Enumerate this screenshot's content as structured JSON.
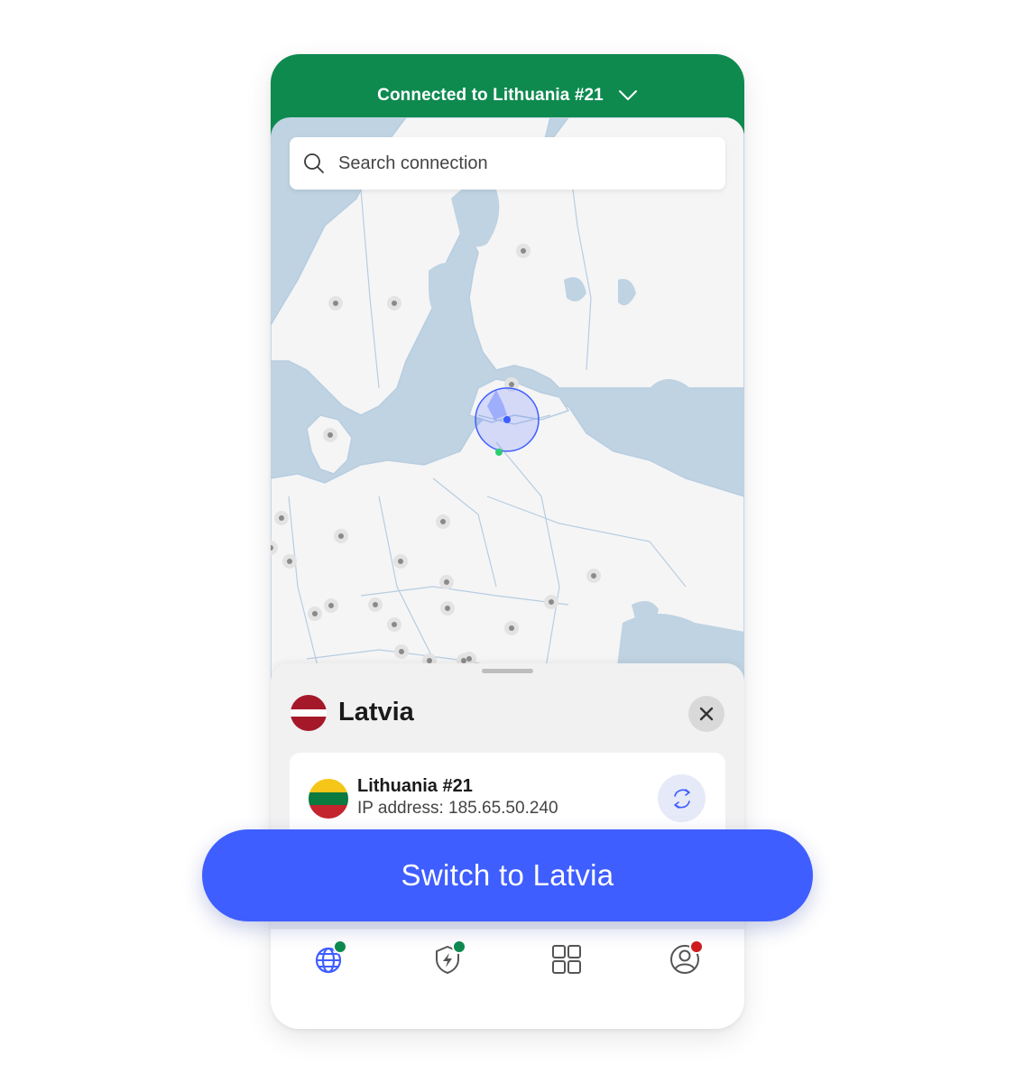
{
  "status": {
    "text": "Connected to Lithuania #21",
    "chevron_icon": "chevron-down-icon",
    "color": "#0e8a4f"
  },
  "search": {
    "placeholder": "Search connection",
    "icon": "search-icon"
  },
  "map": {
    "water_color": "#bfd3e2",
    "land_color": "#f5f5f6",
    "border_color": "#b7cde0",
    "selected_marker_color": "#3f5eff",
    "connected_marker_color": "#2ecc71"
  },
  "sheet": {
    "country": "Latvia",
    "close_icon": "close-icon",
    "server": {
      "name": "Lithuania #21",
      "ip": "IP address: 185.65.50.240",
      "refresh_icon": "refresh-icon"
    }
  },
  "action": {
    "label": "Switch to Latvia",
    "color": "#3f5eff"
  },
  "nav": {
    "items": [
      {
        "icon": "globe-icon",
        "badge_color": "#0e8a4f"
      },
      {
        "icon": "shield-bolt-icon",
        "badge_color": "#0e8a4f"
      },
      {
        "icon": "grid-icon",
        "badge_color": ""
      },
      {
        "icon": "profile-icon",
        "badge_color": "#d01c1f"
      }
    ]
  }
}
